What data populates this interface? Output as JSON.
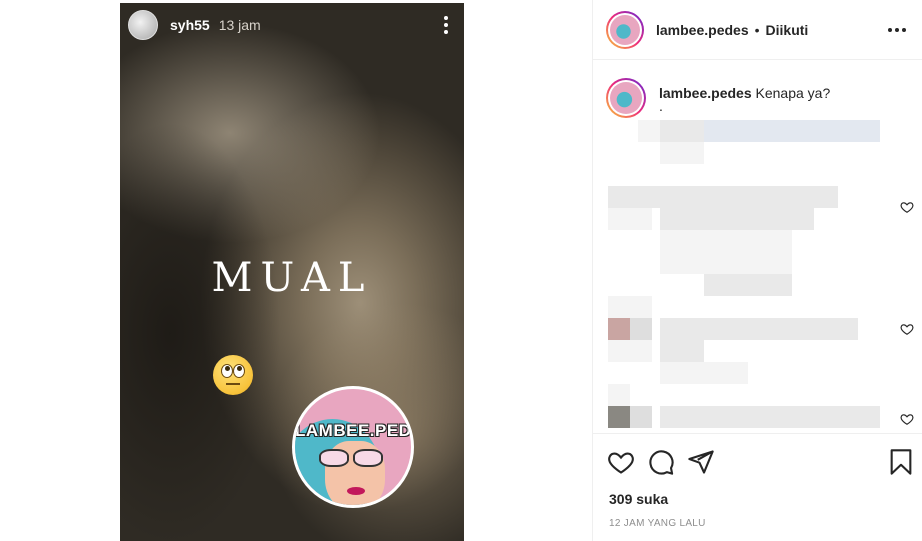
{
  "story": {
    "username": "syh55",
    "time": "13 jam",
    "overlay_text": "MUAL",
    "emoji": "face-with-rolling-eyes",
    "logo_text": "LAMBEE.PEDES"
  },
  "post_header": {
    "username": "lambee.pedes",
    "separator": "•",
    "follow_status": "Diikuti"
  },
  "caption": {
    "username": "lambee.pedes",
    "text": "Kenapa ya?",
    "extra": "."
  },
  "likes": "309 suka",
  "timestamp": "12 JAM YANG LALU",
  "colors": {
    "text": "#262626",
    "secondary": "#8e8e8e",
    "story_ring": [
      "#f9ce34",
      "#ee2a7b",
      "#6228d7"
    ]
  },
  "icons": [
    "more-icon",
    "heart-icon",
    "comment-icon",
    "share-icon",
    "bookmark-icon",
    "comment-like-icon"
  ]
}
